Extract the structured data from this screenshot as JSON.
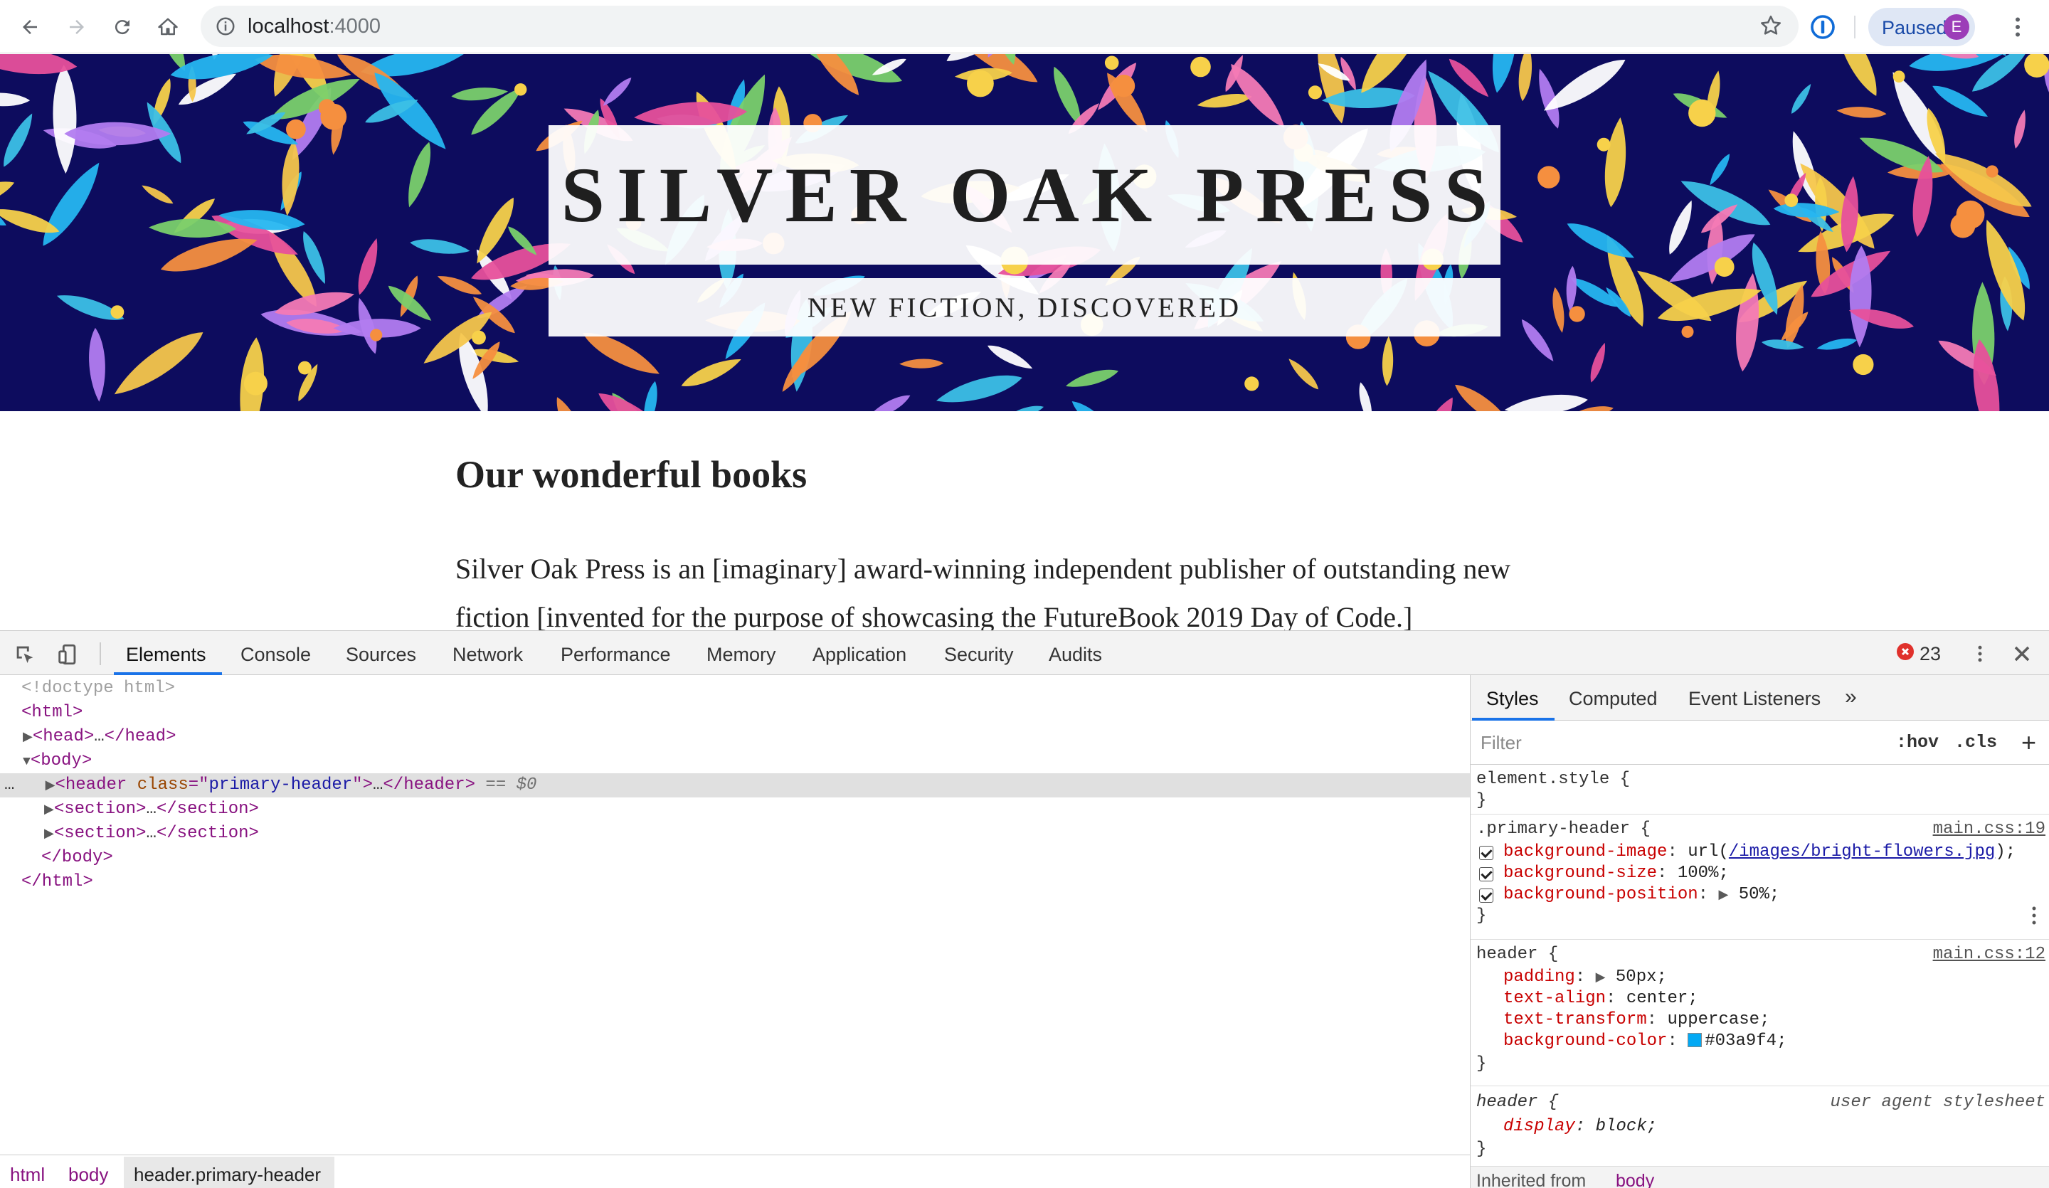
{
  "browser": {
    "url_host": "localhost",
    "url_port": ":4000",
    "profile_status": "Paused",
    "profile_initial": "E"
  },
  "page": {
    "site_title": "SILVER OAK PRESS",
    "tagline": "NEW FICTION, DISCOVERED",
    "heading": "Our wonderful books",
    "intro": "Silver Oak Press is an [imaginary] award-winning independent publisher of outstanding new fiction [invented for the purpose of showcasing the FutureBook 2019 Day of Code.]"
  },
  "devtools": {
    "tabs": [
      "Elements",
      "Console",
      "Sources",
      "Network",
      "Performance",
      "Memory",
      "Application",
      "Security",
      "Audits"
    ],
    "error_count": "23",
    "dom": {
      "doctype": "<!doctype html>",
      "html_open": "<html>",
      "head_open": "<head>",
      "ellipsis": "…",
      "head_close": "</head>",
      "body_open": "<body>",
      "header_tag": "<header",
      "class_attr": "class",
      "eq": "=\"",
      "class_value": "primary-header",
      "quote_close": "\">",
      "header_close": "</header>",
      "dollar0": "== $0",
      "section_open": "<section>",
      "section_close": "</section>",
      "body_close": "</body>",
      "html_close": "</html>",
      "gutter": "…"
    },
    "breadcrumbs": [
      "html",
      "body",
      "header.primary-header"
    ],
    "styles": {
      "tabs": [
        "Styles",
        "Computed",
        "Event Listeners"
      ],
      "more": "»",
      "filter_placeholder": "Filter",
      "hov": ":hov",
      "cls": ".cls",
      "plus": "+",
      "open_brace": " {",
      "close_brace": "}",
      "colon": ":",
      "semicolon": ";",
      "element_style": "element.style",
      "rule1": {
        "selector": ".primary-header",
        "source": "main.css:19",
        "bg_image_prop": "background-image",
        "url_open": " url(",
        "url_link": "/images/bright-flowers.jpg",
        "url_close": ");",
        "bg_size_prop": "background-size",
        "bg_size_val": " 100%;",
        "bg_pos_prop": "background-position",
        "bg_pos_val": " 50%;"
      },
      "rule2": {
        "selector": "header",
        "source": "main.css:12",
        "padding_prop": "padding",
        "padding_val": " 50px;",
        "text_align_prop": "text-align",
        "text_align_val": " center;",
        "text_transform_prop": "text-transform",
        "text_transform_val": " uppercase;",
        "bg_color_prop": "background-color",
        "bg_color_val": "#03a9f4;"
      },
      "rule3": {
        "selector": "header",
        "source": "user agent stylesheet",
        "display_prop": "display",
        "display_val": " block;"
      },
      "inherited_label": "Inherited from",
      "inherited_target": "body"
    }
  },
  "colors": {
    "header_background": "#0d0c5e",
    "devtools_accent": "#1a73e8",
    "swatch": "#03a9f4",
    "error": "#e0312c"
  },
  "icons": [
    "back-arrow-icon",
    "forward-arrow-icon",
    "reload-icon",
    "home-icon",
    "info-icon",
    "star-icon",
    "password-manager-icon",
    "kebab-menu-icon",
    "inspect-element-icon",
    "device-toolbar-icon",
    "error-icon",
    "close-icon"
  ]
}
